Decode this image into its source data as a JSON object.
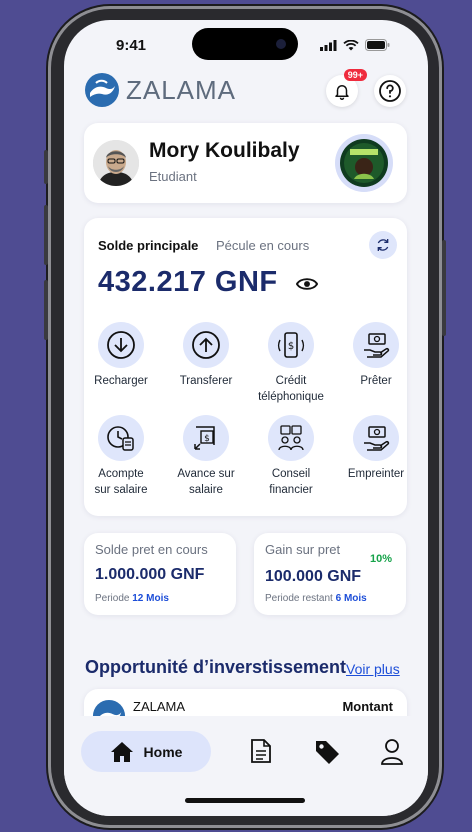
{
  "status": {
    "time": "9:41"
  },
  "header": {
    "brand": "ZALAMA",
    "notif_badge": "99+"
  },
  "profile": {
    "name": "Mory Koulibaly",
    "role": "Etudiant"
  },
  "balance": {
    "tab_main": "Solde principale",
    "tab_other": "Pécule en cours",
    "amount": "432.217 GNF"
  },
  "actions": [
    {
      "label": "Recharger",
      "icon": "download-circle-icon"
    },
    {
      "label": "Transferer",
      "icon": "upload-circle-icon"
    },
    {
      "label": "Crédit\ntéléphonique",
      "icon": "phone-credit-icon"
    },
    {
      "label": "Prêter",
      "icon": "hand-money-icon"
    },
    {
      "label": "Acompte\nsur salaire",
      "icon": "clock-salary-icon"
    },
    {
      "label": "Avance sur\nsalaire",
      "icon": "salary-advance-icon"
    },
    {
      "label": "Conseil\nfinancier",
      "icon": "advisor-icon"
    },
    {
      "label": "Empreinter",
      "icon": "borrow-money-icon"
    }
  ],
  "loan": {
    "title": "Solde pret en cours",
    "amount": "1.000.000 GNF",
    "period_label": "Periode",
    "period_value": "12 Mois"
  },
  "gain": {
    "title": "Gain sur pret",
    "amount": "100.000 GNF",
    "percent": "10%",
    "period_label": "Periode restant",
    "period_value": "6 Mois"
  },
  "opportunities": {
    "title": "Opportunité d’inverstissement",
    "link": "Voir plus",
    "item_name": "ZALAMA",
    "item_amount_label": "Montant"
  },
  "nav": {
    "home_label": "Home"
  },
  "colors": {
    "primary": "#1b2b6b",
    "accent": "#1d4ed8",
    "background": "#4f4c92",
    "badge": "#ef2b3d",
    "success": "#16a34a"
  }
}
